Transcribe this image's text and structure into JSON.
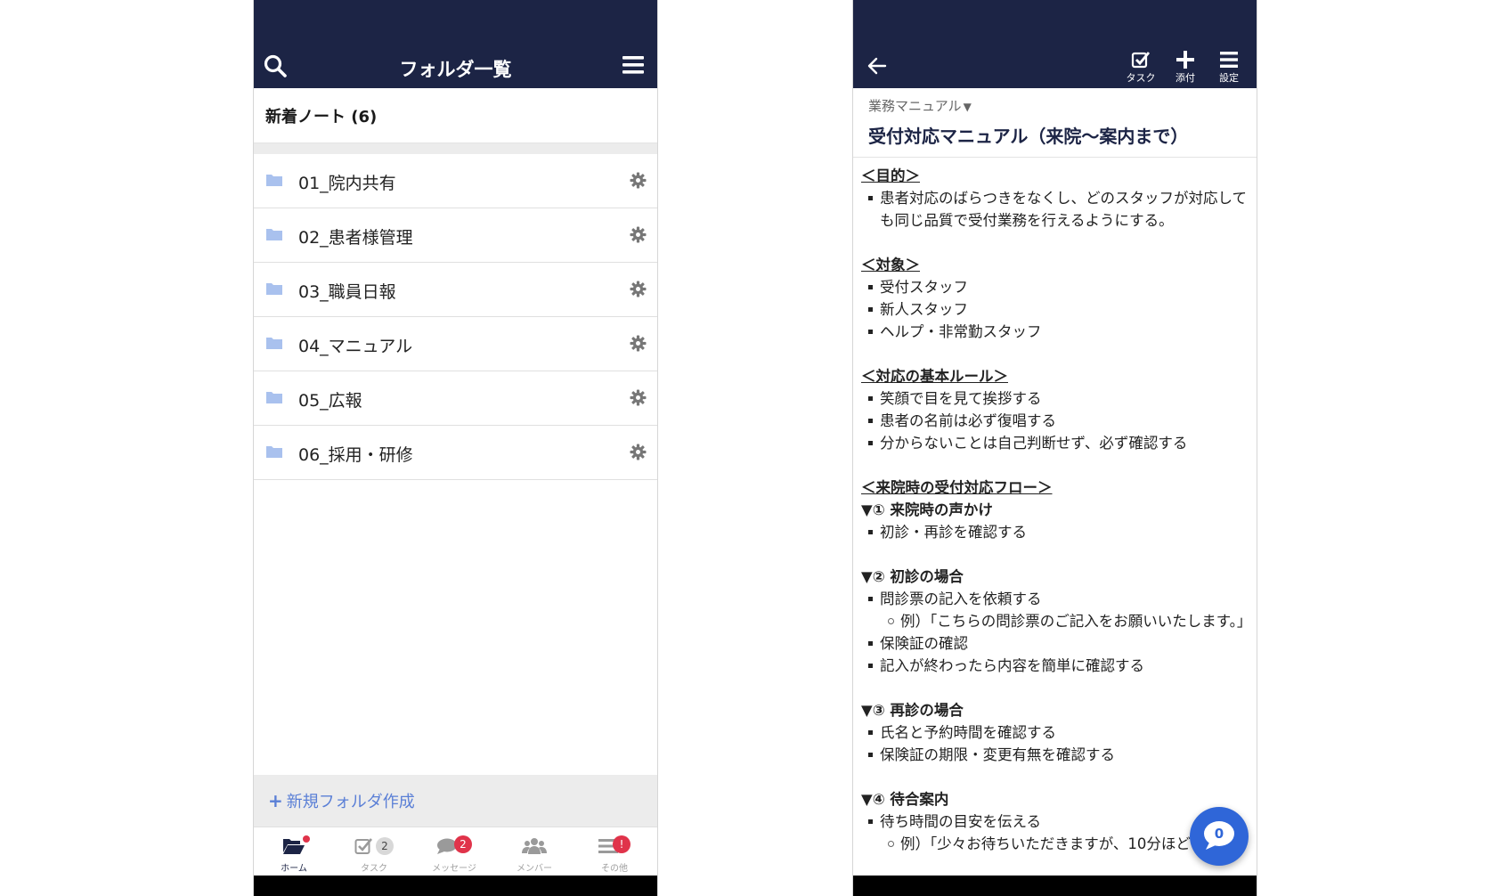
{
  "left_screen": {
    "header": {
      "title": "フォルダ一覧",
      "search_icon": "search-icon",
      "menu_icon": "hamburger-menu-icon"
    },
    "new_notes_label": "新着ノート (6)",
    "folders": [
      {
        "name": "01_院内共有"
      },
      {
        "name": "02_患者様管理"
      },
      {
        "name": "03_職員日報"
      },
      {
        "name": "04_マニュアル"
      },
      {
        "name": "05_広報"
      },
      {
        "name": "06_採用・研修"
      }
    ],
    "new_folder_label": "新規フォルダ作成",
    "bottom_nav": [
      {
        "label": "ホーム",
        "icon": "folder-open-icon",
        "badge": ""
      },
      {
        "label": "タスク",
        "icon": "task-check-icon",
        "badge": "2"
      },
      {
        "label": "メッセージ",
        "icon": "chat-icon",
        "badge": "2"
      },
      {
        "label": "メンバー",
        "icon": "members-icon",
        "badge": ""
      },
      {
        "label": "その他",
        "icon": "more-list-icon",
        "badge": "!"
      }
    ]
  },
  "right_screen": {
    "header": {
      "back_icon": "back-arrow-icon",
      "buttons": [
        {
          "label": "タスク",
          "icon": "task-check-icon"
        },
        {
          "label": "添付",
          "icon": "plus-icon"
        },
        {
          "label": "設定",
          "icon": "hamburger-menu-icon"
        }
      ]
    },
    "folder_link": "業務マニュアル",
    "doc_title": "受付対応マニュアル（来院〜案内まで）",
    "content": {
      "purpose_heading": "＜目的＞",
      "purpose_items": [
        "患者対応のばらつきをなくし、どのスタッフが対応しても同じ品質で受付業務を行えるようにする。"
      ],
      "target_heading": "＜対象＞",
      "target_items": [
        "受付スタッフ",
        "新人スタッフ",
        "ヘルプ・非常勤スタッフ"
      ],
      "rules_heading": "＜対応の基本ルール＞",
      "rules_items": [
        "笑顔で目を見て挨拶する",
        "患者の名前は必ず復唱する",
        "分からないことは自己判断せず、必ず確認する"
      ],
      "flow_heading": "＜来院時の受付対応フロー＞",
      "step1_heading": "▼① 来院時の声かけ",
      "step1_items": [
        "初診・再診を確認する"
      ],
      "step2_heading": "▼② 初診の場合",
      "step2_item1": "問診票の記入を依頼する",
      "step2_example": "例）「こちらの問診票のご記入をお願いいたします。」",
      "step2_item2": "保険証の確認",
      "step2_item3": "記入が終わったら内容を簡単に確認する",
      "step3_heading": "▼③ 再診の場合",
      "step3_items": [
        "氏名と予約時間を確認する",
        "保険証の期限・変更有無を確認する"
      ],
      "step4_heading": "▼④ 待合案内",
      "step4_item1": "待ち時間の目安を伝える",
      "step4_example": "例）「少々お待ちいただきますが、10分ほどで"
    },
    "chat_fab_count": "0"
  }
}
